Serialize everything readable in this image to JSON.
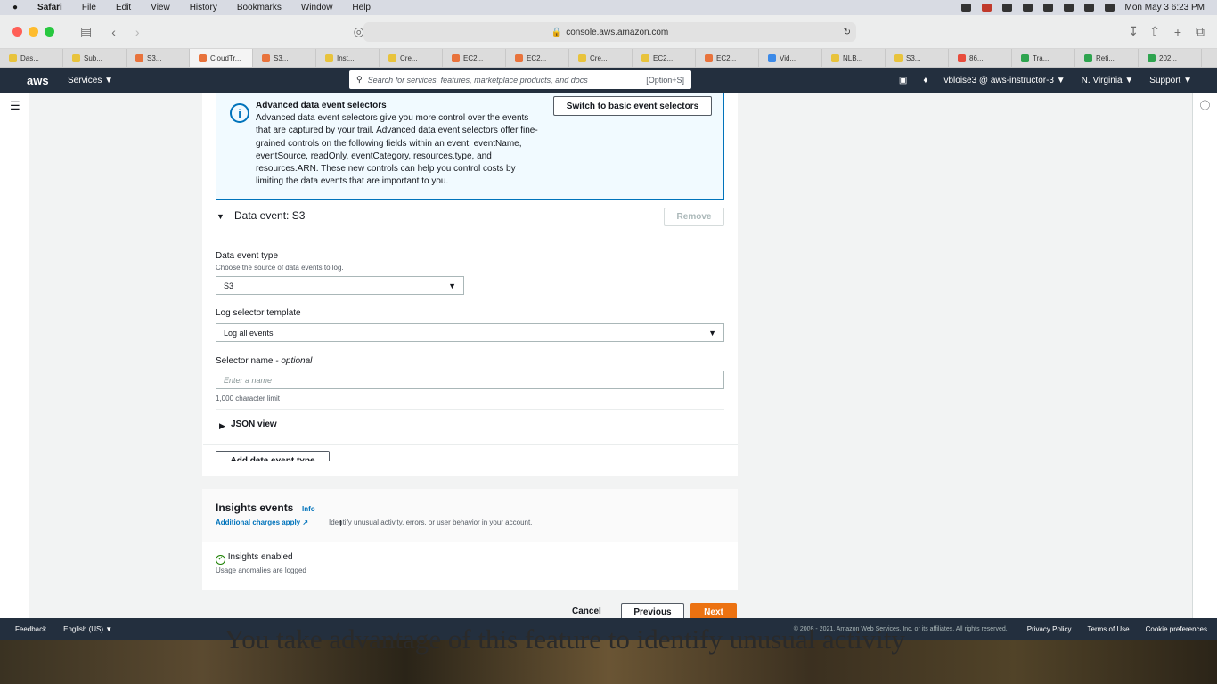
{
  "mac_menubar": {
    "apple": "",
    "app": "Safari",
    "items": [
      "File",
      "Edit",
      "View",
      "History",
      "Bookmarks",
      "Window",
      "Help"
    ],
    "clock": "Mon May 3  6:23 PM"
  },
  "browser": {
    "url": "console.aws.amazon.com",
    "tabs": [
      {
        "label": "Das...",
        "color": "#e8c33c"
      },
      {
        "label": "Sub...",
        "color": "#e8c33c"
      },
      {
        "label": "S3...",
        "color": "#e8733c"
      },
      {
        "label": "CloudTr...",
        "color": "#e8733c",
        "active": true
      },
      {
        "label": "S3...",
        "color": "#e8733c"
      },
      {
        "label": "Inst...",
        "color": "#e8c33c"
      },
      {
        "label": "Cre...",
        "color": "#e8c33c"
      },
      {
        "label": "EC2...",
        "color": "#e8733c"
      },
      {
        "label": "EC2...",
        "color": "#e8733c"
      },
      {
        "label": "Cre...",
        "color": "#e8c33c"
      },
      {
        "label": "EC2...",
        "color": "#e8c33c"
      },
      {
        "label": "EC2...",
        "color": "#e8733c"
      },
      {
        "label": "Vid...",
        "color": "#3c8ae8"
      },
      {
        "label": "NLB...",
        "color": "#e8c33c"
      },
      {
        "label": "S3...",
        "color": "#e8c33c"
      },
      {
        "label": "86...",
        "color": "#e84c3c"
      },
      {
        "label": "Tra...",
        "color": "#2ea44f"
      },
      {
        "label": "Reti...",
        "color": "#2ea44f"
      },
      {
        "label": "202...",
        "color": "#2ea44f"
      }
    ]
  },
  "aws_nav": {
    "logo": "aws",
    "services": "Services ▼",
    "search_placeholder": "Search for services, features, marketplace products, and docs",
    "search_shortcut": "[Option+S]",
    "account": "vbloise3 @ aws-instructor-3 ▼",
    "region": "N. Virginia ▼",
    "support": "Support ▼"
  },
  "info_alert": {
    "title": "Advanced data event selectors",
    "text": "Advanced data event selectors give you more control over the events that are captured by your trail. Advanced data event selectors offer fine-grained controls on the following fields within an event: eventName, eventSource, readOnly, eventCategory, resources.type, and resources.ARN. These new controls can help you control costs by limiting the data events that are important to you.",
    "switch_button": "Switch to basic event selectors"
  },
  "data_event": {
    "section_title": "Data event: S3",
    "remove_button": "Remove",
    "type_label": "Data event type",
    "type_hint": "Choose the source of data events to log.",
    "type_value": "S3",
    "template_label": "Log selector template",
    "template_value": "Log all events",
    "selector_label": "Selector name",
    "selector_optional": "- optional",
    "selector_placeholder": "Enter a name",
    "selector_limit": "1,000 character limit",
    "json_view": "JSON view",
    "add_button": "Add data event type"
  },
  "insights": {
    "title": "Insights events",
    "info_link": "Info",
    "charges_link": "Additional charges apply",
    "description": "Identify unusual activity, errors, or user behavior in your account.",
    "status": "Insights enabled",
    "status_detail": "Usage anomalies are logged"
  },
  "wizard_buttons": {
    "cancel": "Cancel",
    "previous": "Previous",
    "next": "Next"
  },
  "footer": {
    "feedback": "Feedback",
    "language": "English (US) ▼",
    "copyright": "© 2008 - 2021, Amazon Web Services, Inc. or its affiliates. All rights reserved.",
    "privacy": "Privacy Policy",
    "terms": "Terms of Use",
    "cookies": "Cookie preferences"
  },
  "caption": "You take advantage of this feature to identify unusual activity",
  "colors": {
    "aws_nav": "#232f3e",
    "primary_button": "#ec7211",
    "info_border": "#0073bb",
    "success": "#1d8102"
  }
}
